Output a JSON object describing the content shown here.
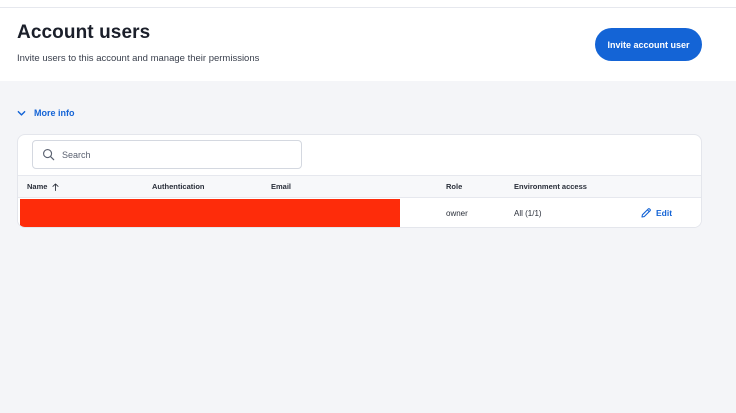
{
  "header": {
    "title": "Account users",
    "subtitle": "Invite users to this account and manage their permissions",
    "invite_button": "Invite account user"
  },
  "more_info": {
    "label": "More info",
    "icon": "chevron-down-icon"
  },
  "search": {
    "placeholder": "Search",
    "value": "",
    "icon": "search-icon"
  },
  "table": {
    "columns": [
      {
        "label": "Name",
        "sort": "ascending"
      },
      {
        "label": "Authentication"
      },
      {
        "label": "Email"
      },
      {
        "label": "Role"
      },
      {
        "label": "Environment access"
      }
    ],
    "rows": [
      {
        "role": "owner",
        "environment_access": "All (1/1)",
        "action": "Edit"
      }
    ]
  },
  "colors": {
    "accent": "#1464d6",
    "background": "#f4f5f8",
    "redaction": "#fe2c0a"
  }
}
